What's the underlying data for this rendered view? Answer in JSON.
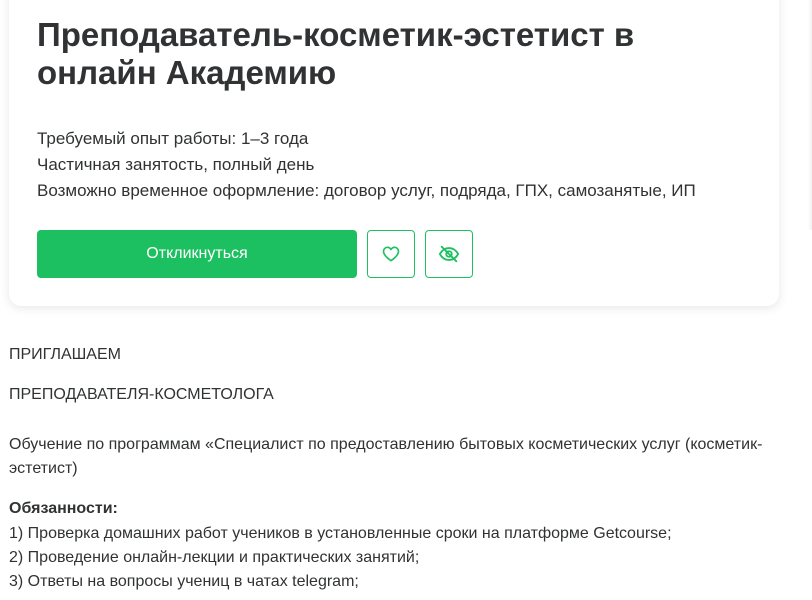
{
  "vacancy": {
    "title": "Преподаватель-косметик-эстетист в онлайн Академию",
    "meta": [
      "Требуемый опыт работы: 1–3 года",
      "Частичная занятость, полный день",
      "Возможно временное оформление: договор услуг, подряда, ГПХ, самозанятые, ИП"
    ],
    "apply_label": "Откликнуться",
    "icons": {
      "favorite": "heart-icon",
      "hide": "eye-off-icon"
    },
    "colors": {
      "accent": "#1dc060",
      "text": "#303233"
    }
  },
  "description": {
    "line1": "ПРИГЛАШАЕМ",
    "line2": "ПРЕПОДАВАТЕЛЯ-КОСМЕТОЛОГА",
    "line3": "Обучение по программам «Специалист по предоставлению бытовых косметических услуг (косметик-эстетист)",
    "responsibilities_title": "Обязанности:",
    "responsibilities": [
      "1) Проверка домашних работ учеников в установленные сроки на платформе Getcourse;",
      "2) Проведение онлайн-лекции и практических занятий;",
      "3) Ответы на вопросы учениц в чатах telegram;"
    ]
  }
}
